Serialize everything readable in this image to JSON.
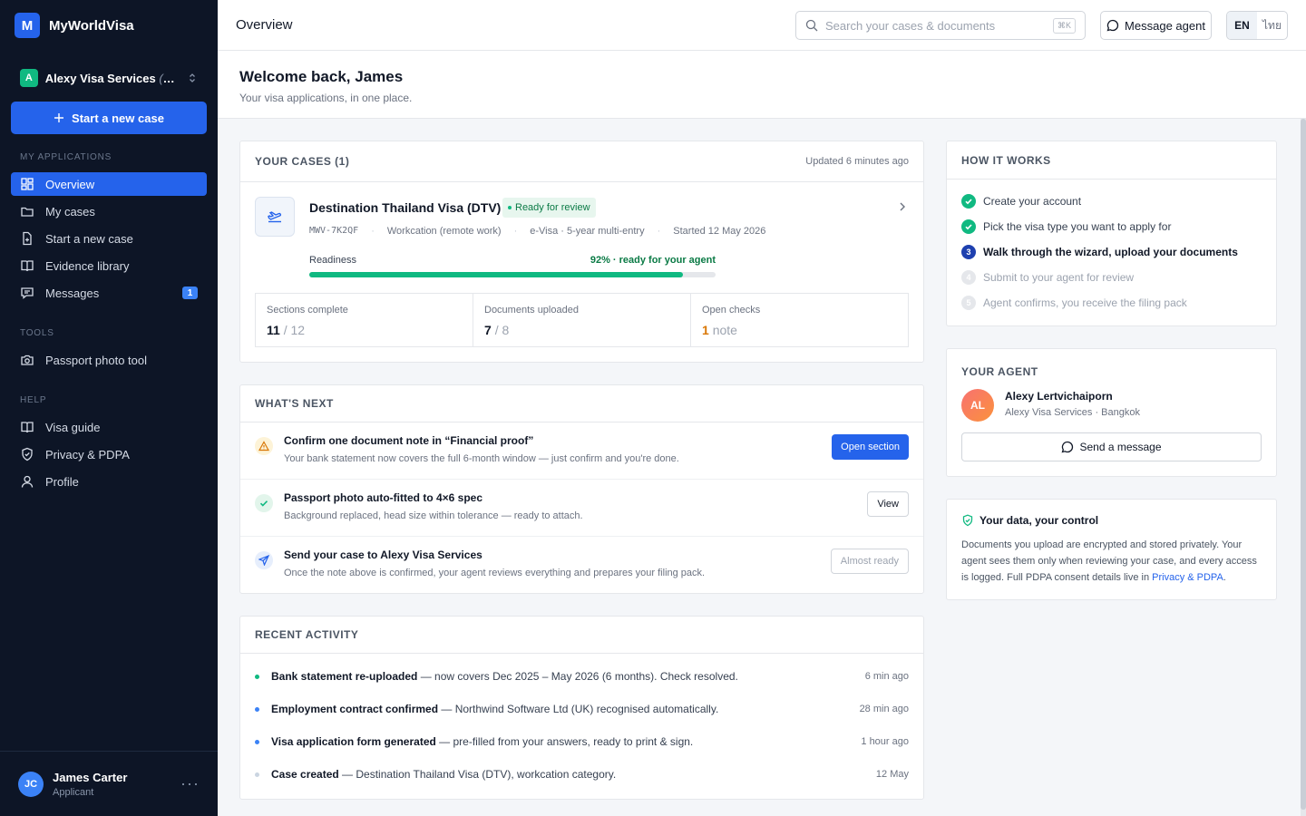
{
  "brand": {
    "logo_letter": "M",
    "name": "MyWorldVisa"
  },
  "workspace": {
    "badge": "A",
    "name": "Alexy Visa Services",
    "suffix": "(your agent)"
  },
  "sidebar": {
    "start_button": "Start a new case",
    "section_applications": "MY APPLICATIONS",
    "items": [
      {
        "label": "Overview",
        "icon": "grid-icon",
        "active": true
      },
      {
        "label": "My cases",
        "icon": "folder-icon"
      },
      {
        "label": "Start a new case",
        "icon": "file-plus-icon"
      },
      {
        "label": "Evidence library",
        "icon": "book-icon"
      },
      {
        "label": "Messages",
        "icon": "chat-icon",
        "badge": "1"
      }
    ],
    "section_tools": "TOOLS",
    "tools": [
      {
        "label": "Passport photo tool",
        "icon": "camera-icon"
      }
    ],
    "section_help": "HELP",
    "help": [
      {
        "label": "Visa guide",
        "icon": "book-icon"
      },
      {
        "label": "Privacy & PDPA",
        "icon": "shield-icon"
      },
      {
        "label": "Profile",
        "icon": "user-icon"
      }
    ],
    "user": {
      "initials": "JC",
      "name": "James Carter",
      "role": "Applicant",
      "more": "···"
    }
  },
  "topbar": {
    "title": "Overview",
    "search_placeholder": "Search your cases & documents",
    "search_shortcut": "⌘K",
    "message_agent": "Message agent",
    "lang_en": "EN",
    "lang_th": "ไทย"
  },
  "welcome": {
    "title": "Welcome back, James",
    "subtitle": "Your visa applications, in one place."
  },
  "cases": {
    "title": "YOUR CASES (1)",
    "updated": "Updated 6 minutes ago",
    "case": {
      "name": "Destination Thailand Visa (DTV)",
      "status": "Ready for review",
      "id": "MWV-7K2QF",
      "category": "Workcation (remote work)",
      "type": "e-Visa · 5-year multi-entry",
      "started": "Started 12 May 2026",
      "readiness_label": "Readiness",
      "readiness_text": "92% · ready for your agent",
      "readiness_fraction": 0.92
    },
    "stats": [
      {
        "label": "Sections complete",
        "value": "11",
        "total": "/ 12"
      },
      {
        "label": "Documents uploaded",
        "value": "7",
        "total": "/ 8"
      },
      {
        "label": "Open checks",
        "value": "1",
        "total": "note"
      }
    ]
  },
  "next": {
    "title": "WHAT'S NEXT",
    "items": [
      {
        "title": "Confirm one document note in “Financial proof”",
        "sub": "Your bank statement now covers the full 6-month window — just confirm and you're done.",
        "button": "Open section"
      },
      {
        "title": "Passport photo auto-fitted to 4×6 spec",
        "sub": "Background replaced, head size within tolerance — ready to attach.",
        "button": "View"
      },
      {
        "title": "Send your case to Alexy Visa Services",
        "sub": "Once the note above is confirmed, your agent reviews everything and prepares your filing pack.",
        "button": "Almost ready"
      }
    ]
  },
  "activity": {
    "title": "RECENT ACTIVITY",
    "items": [
      {
        "bold": "Bank statement re-uploaded",
        "rest": " — now covers Dec 2025 – May 2026 (6 months). Check resolved.",
        "time": "6 min ago",
        "color": "#10b981"
      },
      {
        "bold": "Employment contract confirmed",
        "rest": " — Northwind Software Ltd (UK) recognised automatically.",
        "time": "28 min ago",
        "color": "#3b82f6"
      },
      {
        "bold": "Visa application form generated",
        "rest": " — pre-filled from your answers, ready to print & sign.",
        "time": "1 hour ago",
        "color": "#3b82f6"
      },
      {
        "bold": "Case created",
        "rest": " — Destination Thailand Visa (DTV), workcation category.",
        "time": "12 May",
        "color": "#cbd5e1"
      }
    ]
  },
  "how": {
    "title": "HOW IT WORKS",
    "steps": [
      {
        "label": "Create your account",
        "state": "done"
      },
      {
        "label": "Pick the visa type you want to apply for",
        "state": "done"
      },
      {
        "label": "Walk through the wizard, upload your documents",
        "state": "current",
        "num": "3"
      },
      {
        "label": "Submit to your agent for review",
        "state": "todo",
        "num": "4"
      },
      {
        "label": "Agent confirms, you receive the filing pack",
        "state": "todo",
        "num": "5"
      }
    ]
  },
  "agent": {
    "title": "YOUR AGENT",
    "initials": "AL",
    "name": "Alexy Lertvichaiporn",
    "org": "Alexy Visa Services · Bangkok",
    "button": "Send a message"
  },
  "privacy": {
    "title": "Your data, your control",
    "body": "Documents you upload are encrypted and stored privately. Your agent sees them only when reviewing your case, and every access is logged. Full PDPA consent details live in ",
    "link": "Privacy & PDPA",
    "end": "."
  }
}
